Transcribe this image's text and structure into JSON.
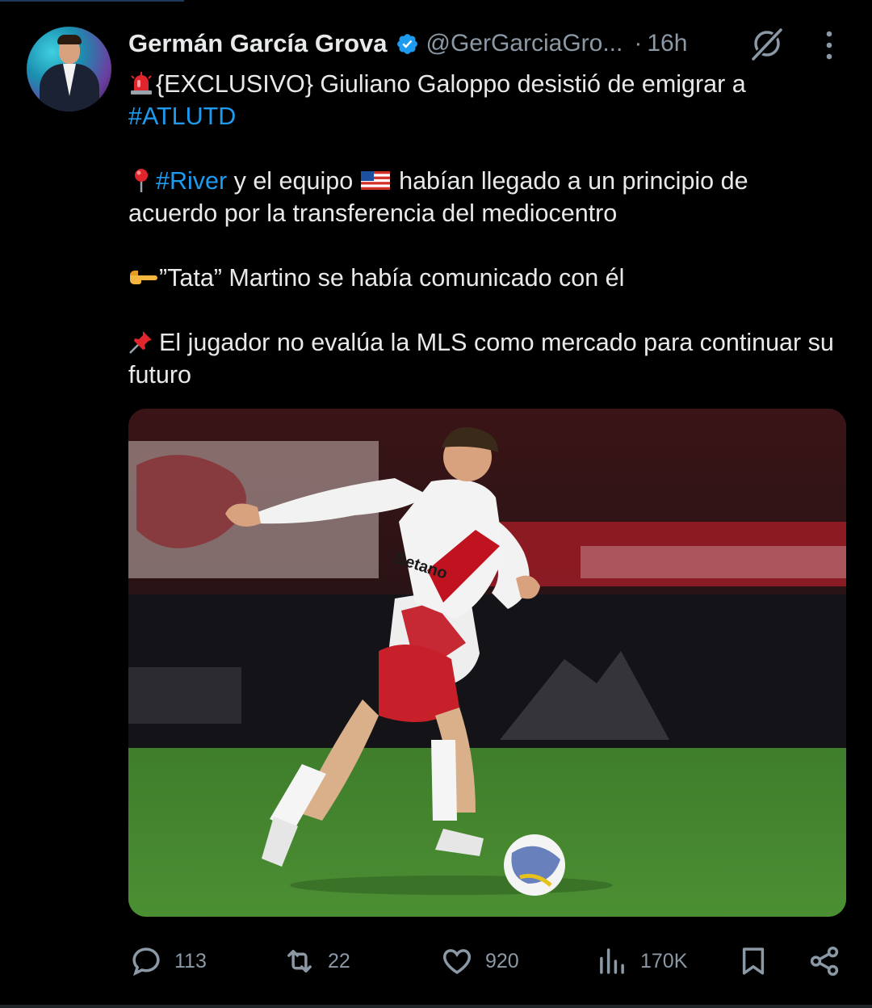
{
  "author": {
    "name": "Germán García Grova",
    "handle": "@GerGarciaGro...",
    "separator": "·",
    "time": "16h"
  },
  "tweet": {
    "line1_text": "{EXCLUSIVO} Giuliano Galoppo desistió de emigrar a",
    "line1_hashtag": "#ATLUTD",
    "p2_hashtag": "#River",
    "p2_text_a": "y el equipo",
    "p2_text_b": "habían llegado a un principio de acuerdo por la transferencia del mediocentro",
    "p3_text": "”Tata” Martino se había comunicado con él",
    "p4_text": "El jugador no evalúa la MLS como mercado para continuar su futuro",
    "emojis": [
      "rotating-light",
      "round-pushpin",
      "us-flag",
      "backhand-index-pointing-right",
      "pushpin"
    ]
  },
  "media": {
    "jersey_sponsor": "Betano"
  },
  "actions": {
    "replies": "113",
    "reposts": "22",
    "likes": "920",
    "views": "170K"
  },
  "colors": {
    "background": "#000000",
    "text": "#e7e9ea",
    "secondary": "#8b98a5",
    "link": "#1d9bf0",
    "verified": "#1d9bf0"
  }
}
